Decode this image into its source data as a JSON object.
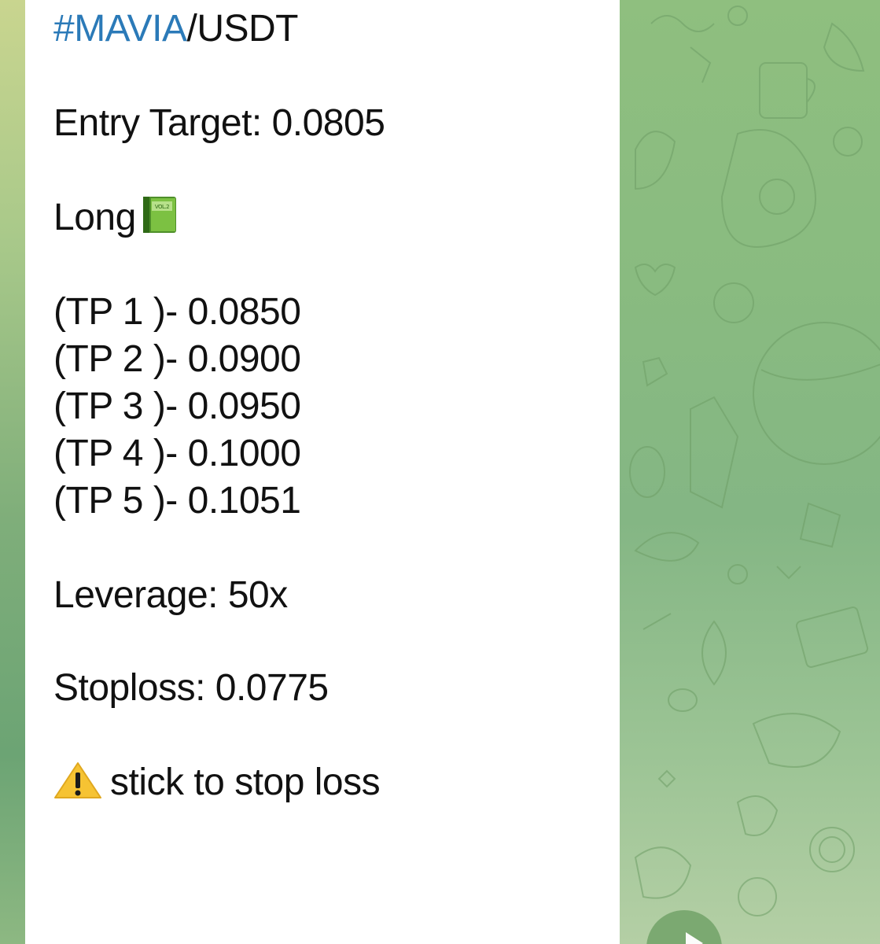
{
  "message": {
    "pair_hashtag": "#MAVIA",
    "pair_suffix": "/USDT",
    "entry_target": "Entry Target: 0.0805",
    "direction": "Long",
    "direction_emoji": "green-book-icon",
    "take_profits": [
      "(TP 1 )- 0.0850",
      "(TP 2 )- 0.0900",
      "(TP 3 )- 0.0950",
      "(TP 4 )- 0.1000",
      "(TP 5 )- 0.1051"
    ],
    "leverage": "Leverage: 50x",
    "stoploss": "Stoploss: 0.0775",
    "warning_text": "stick to stop loss",
    "warning_emoji": "warning-icon",
    "book_label": "VOL.2"
  },
  "colors": {
    "hashtag": "#2b7ab8",
    "bubble_background": "#ffffff",
    "wallpaper": "#8dbc82",
    "fab": "#79a86f"
  },
  "fab_icon": "share-arrow-icon"
}
